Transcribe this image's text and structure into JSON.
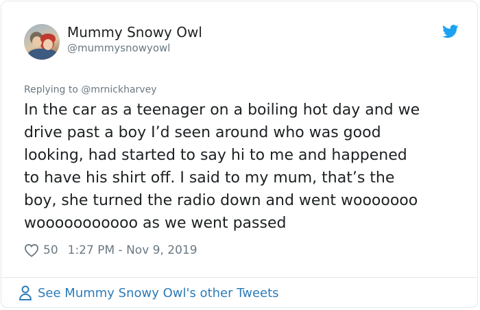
{
  "author": {
    "display_name": "Mummy Snowy Owl",
    "handle": "@mummysnowyowl"
  },
  "icons": {
    "platform": "twitter-bird-icon",
    "like": "heart-icon",
    "profile": "person-icon"
  },
  "tweet": {
    "replying_to": "Replying to @mrnickharvey",
    "text": "In the car as a teenager on a boiling hot day and we\ndrive past a boy I’d seen around who was good\nlooking, had started to say hi to me and happened\nto have his shirt off. I said to my mum, that’s the\nboy, she turned the radio down and went wooooooo\nwooooooooooo as we went passed",
    "likes": "50",
    "timestamp": "1:27 PM - Nov 9, 2019"
  },
  "footer": {
    "link_text": "See Mummy Snowy Owl's other Tweets"
  },
  "colors": {
    "brand_blue": "#1da1f2",
    "link_blue": "#2b7bb9",
    "text": "#1c2022",
    "muted": "#697882",
    "border": "#e1e8ed"
  }
}
